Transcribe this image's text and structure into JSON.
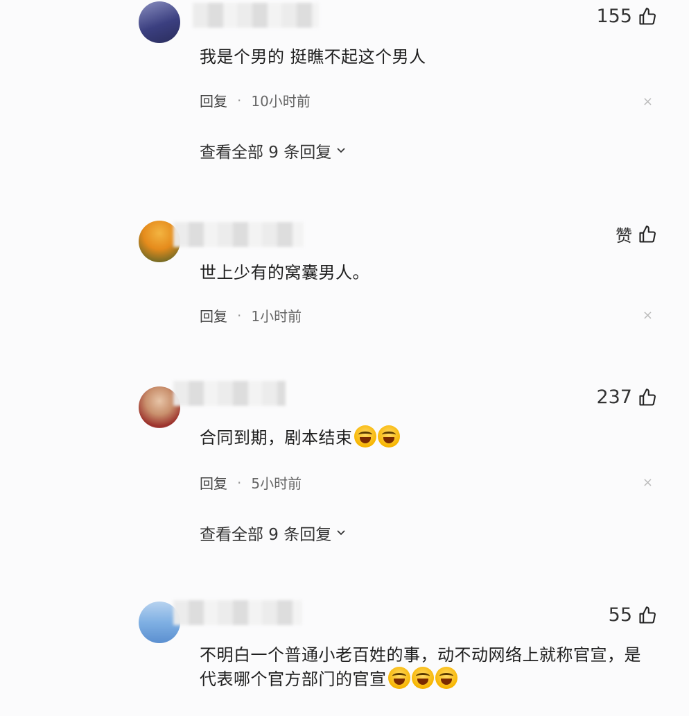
{
  "comments": [
    {
      "like_count": "155",
      "text": "我是个男的 挺瞧不起这个男人",
      "reply_label": "回复",
      "time": "10小时前",
      "view_more": "查看全部 9 条回复"
    },
    {
      "like_count": "赞",
      "text": "世上少有的窝囊男人。",
      "reply_label": "回复",
      "time": "1小时前"
    },
    {
      "like_count": "237",
      "text": "合同到期，剧本结束",
      "reply_label": "回复",
      "time": "5小时前",
      "view_more": "查看全部 9 条回复"
    },
    {
      "like_count": "55",
      "text": "不明白一个普通小老百姓的事，动不动网络上就称官宣，是代表哪个官方部门的官宣"
    }
  ],
  "icons": {
    "like": "thumbs-up-icon",
    "close": "close-icon",
    "chevron": "chevron-down-icon",
    "emoji": "laughing-tears-emoji"
  },
  "separator": "·",
  "close_glyph": "×"
}
